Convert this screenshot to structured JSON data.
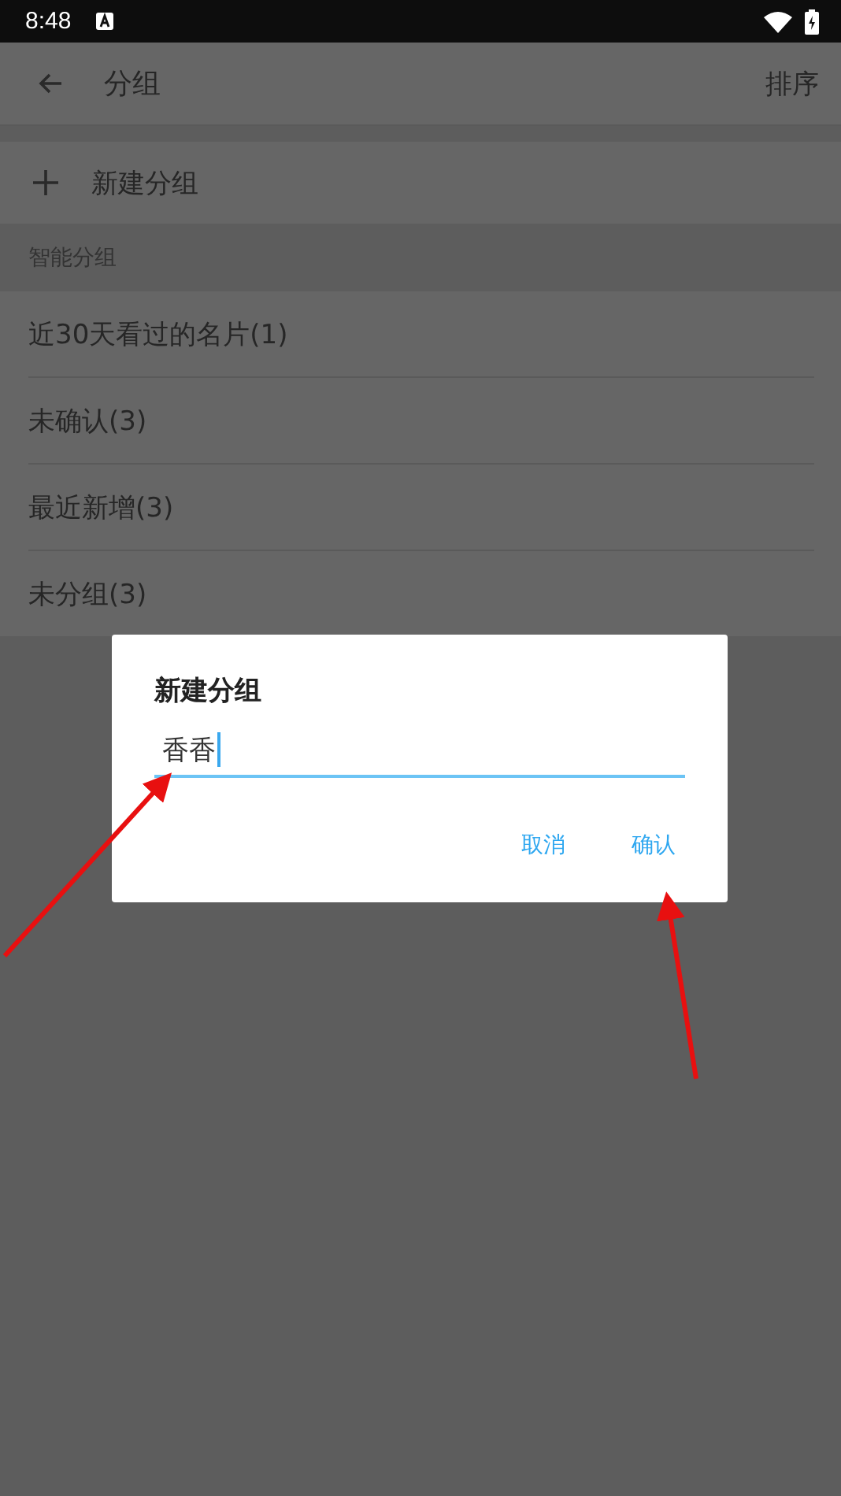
{
  "status_bar": {
    "time": "8:48"
  },
  "app_bar": {
    "title": "分组",
    "action": "排序"
  },
  "new_group": {
    "label": "新建分组"
  },
  "section": {
    "title": "智能分组"
  },
  "groups": [
    {
      "label": "近30天看过的名片(1)"
    },
    {
      "label": "未确认(3)"
    },
    {
      "label": "最近新增(3)"
    },
    {
      "label": "未分组(3)"
    }
  ],
  "dialog": {
    "title": "新建分组",
    "value": "香香",
    "buttons": [
      "取消",
      "确认"
    ]
  }
}
